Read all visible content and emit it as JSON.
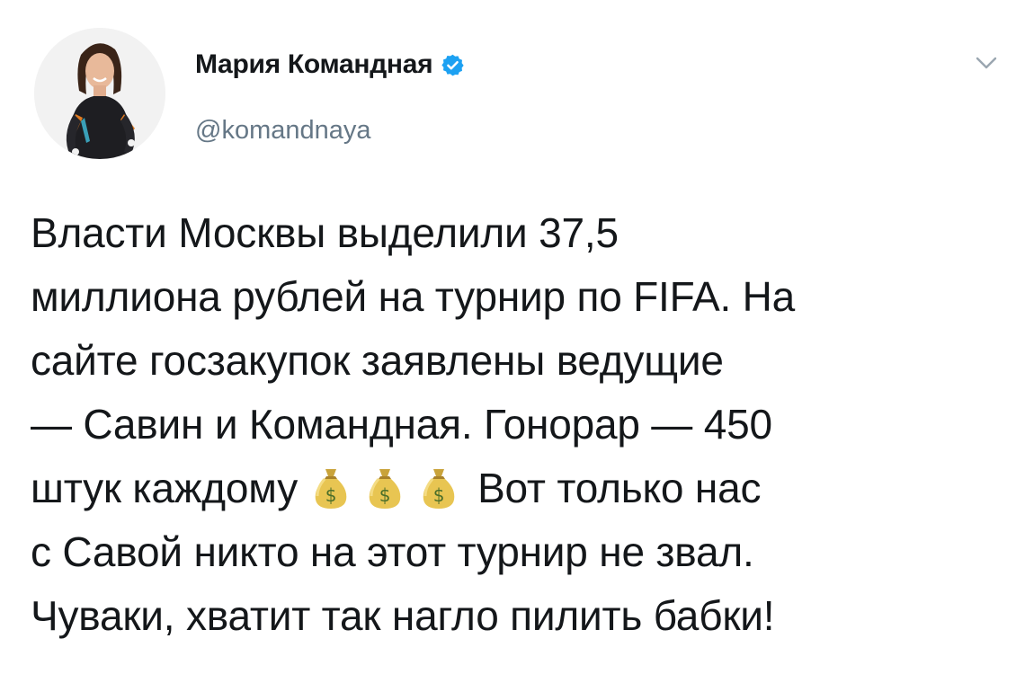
{
  "tweet": {
    "author": {
      "name": "Мария Командная",
      "handle": "@komandnaya",
      "verified": true,
      "verified_color": "#1da1f2"
    },
    "menu_icon": "chevron-down-icon",
    "body": {
      "line1": "Власти Москвы выделили 37,5",
      "line2": "миллиона рублей на турнир по FIFA. На",
      "line3": "сайте госзакупок заявлены ведущие",
      "line4": "— Савин и Командная. Гонорар — 450",
      "line5_before": "штук каждому",
      "line5_emoji": [
        "money-bag-icon",
        "money-bag-icon",
        "money-bag-icon"
      ],
      "line5_after": "Вот только нас",
      "line6": "с Савой никто на этот турнир не звал.",
      "line7": "Чуваки, хватит так нагло пилить бабки!"
    }
  }
}
